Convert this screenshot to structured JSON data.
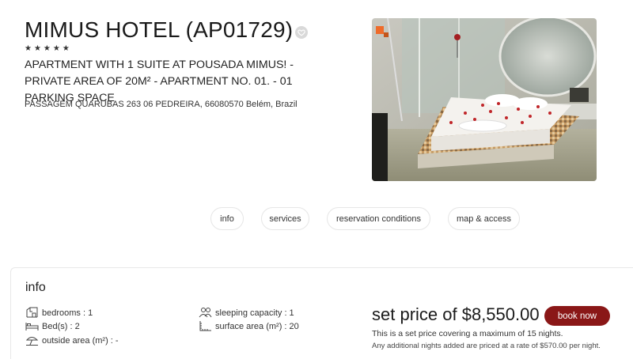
{
  "hotel": {
    "title": "MIMUS HOTEL (AP01729)",
    "stars": "★★★★★",
    "subtitle": "APARTMENT WITH 1 SUITE AT POUSADA MIMUS! - PRIVATE AREA OF 20M² - APARTMENT NO. 01. - 01 PARKING SPACE",
    "address": "PASSAGEM QUARUBAS 263 06 PEDREIRA, 66080570 Belém, Brazil"
  },
  "icons": {
    "favorite": "heart-icon",
    "bedrooms": "bedroom-icon",
    "beds": "bed-icon",
    "outside": "umbrella-icon",
    "sleeping": "people-icon",
    "surface": "area-icon"
  },
  "tabs": [
    {
      "label": "info"
    },
    {
      "label": "services"
    },
    {
      "label": "reservation conditions"
    },
    {
      "label": "map & access"
    }
  ],
  "info": {
    "heading": "info",
    "bedrooms": "bedrooms : 1",
    "beds": "Bed(s) : 2",
    "outside_area": "outside area (m²) : -",
    "sleeping_capacity": "sleeping capacity : 1",
    "surface_area": "surface area (m²) : 20"
  },
  "pricing": {
    "price": "set price of $8,550.00",
    "book_label": "book now",
    "note": "This is a set price covering a maximum of 15 nights.",
    "additional": "Any additional nights added are priced at a rate of $570.00 per night."
  },
  "colors": {
    "accent": "#8a1717",
    "border": "#e6e6e6"
  }
}
